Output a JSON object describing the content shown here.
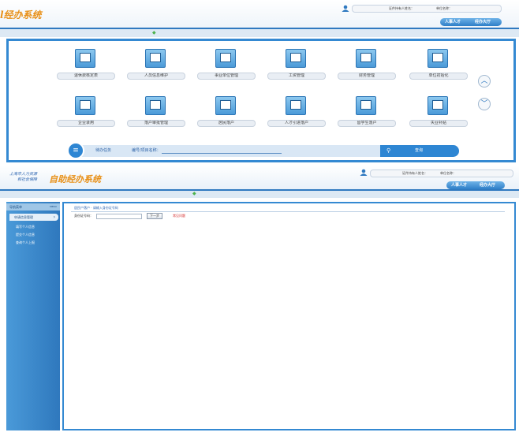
{
  "top_screen": {
    "logo_text": "l经办系统",
    "user_info": {
      "id_label": "证件持有人姓名：",
      "unit_label": "单位名称："
    },
    "tabs": [
      {
        "label": "人事人才"
      },
      {
        "label": "经办大厅"
      }
    ],
    "tiles": [
      {
        "label": "退休费核定表",
        "icon": "printer-icon"
      },
      {
        "label": "人员信息维护",
        "icon": "document-check-icon"
      },
      {
        "label": "事业单位管理",
        "icon": "message-icon"
      },
      {
        "label": "工资管理",
        "icon": "printer-icon"
      },
      {
        "label": "财务管理",
        "icon": "id-card-icon"
      },
      {
        "label": "单位初始化",
        "icon": "monitor-icon"
      },
      {
        "label": "企业录用",
        "icon": "monitor-icon"
      },
      {
        "label": "落户审批管理",
        "icon": "org-chart-icon"
      },
      {
        "label": "居民落户",
        "icon": "safe-icon"
      },
      {
        "label": "人才引进落户",
        "icon": "calendar-icon"
      },
      {
        "label": "留学生落户",
        "icon": "computer-icon"
      },
      {
        "label": "失业补贴",
        "icon": "chart-icon"
      }
    ],
    "search": {
      "task_label": "待办任务",
      "field_label": "编号/项目名称：",
      "button_label": "查询"
    }
  },
  "bottom_screen": {
    "logo_top": "上海市人力资源",
    "logo_bottom": "和社会保障",
    "logo_text": "自助经办系统",
    "user_info": {
      "id_label": "证件持有人姓名：",
      "unit_label": "单位名称："
    },
    "tabs": [
      {
        "label": "人事人才"
      },
      {
        "label": "经办大厅"
      }
    ],
    "sidebar": {
      "header": "导航菜单",
      "header_right": "MENU",
      "active_item": "申请信息管理",
      "items": [
        "填写个人信息",
        "提交个人信息",
        "查询个人上报"
      ]
    },
    "content": {
      "breadcrumb": "居民户落户 · 请输入身份证号码",
      "id_label": "身份证号码：",
      "next_button": "下一步",
      "help_link": "常见问题"
    }
  }
}
